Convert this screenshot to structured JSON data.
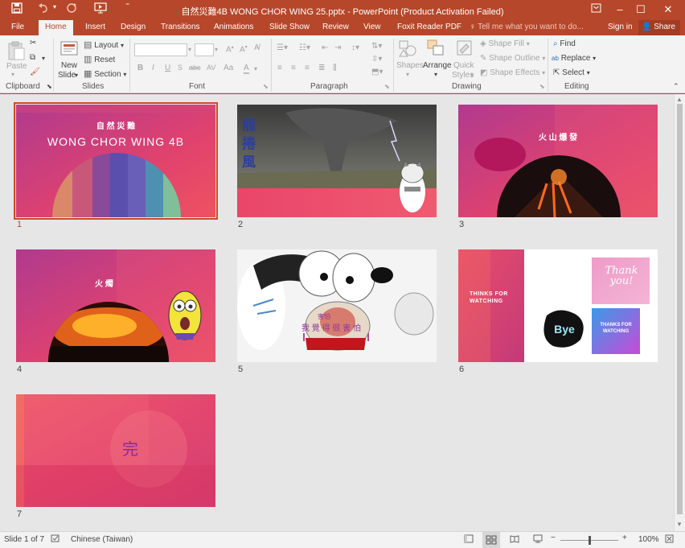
{
  "titlebar": {
    "title": "自然災難4B  WONG CHOR WING  25.pptx - PowerPoint (Product Activation Failed)",
    "save_icon": "save-icon",
    "undo_icon": "undo-icon",
    "redo_icon": "redo-icon",
    "start_icon": "start-from-beginning-icon",
    "customize_icon": "customize-qat-icon"
  },
  "tabs": {
    "file": "File",
    "home": "Home",
    "insert": "Insert",
    "design": "Design",
    "transitions": "Transitions",
    "animations": "Animations",
    "slideshow": "Slide Show",
    "review": "Review",
    "view": "View",
    "foxit": "Foxit Reader PDF",
    "tell": "Tell me what you want to do...",
    "signin": "Sign in",
    "share": "Share"
  },
  "ribbon": {
    "clipboard": {
      "label": "Clipboard",
      "paste": "Paste"
    },
    "slides": {
      "label": "Slides",
      "new_slide": "New",
      "new_slide2": "Slide",
      "layout": "Layout",
      "reset": "Reset",
      "section": "Section"
    },
    "font": {
      "label": "Font",
      "bold": "B",
      "italic": "I",
      "underline": "U",
      "strike": "S",
      "shadow": "abc",
      "spacing": "AV",
      "case": "Aa"
    },
    "paragraph": {
      "label": "Paragraph"
    },
    "drawing": {
      "label": "Drawing",
      "shapes": "Shapes",
      "arrange": "Arrange",
      "quick": "Quick",
      "styles": "Styles",
      "fill": "Shape Fill",
      "outline": "Shape Outline",
      "effects": "Shape Effects"
    },
    "editing": {
      "label": "Editing",
      "find": "Find",
      "replace": "Replace",
      "select": "Select"
    }
  },
  "slides": [
    {
      "num": "1",
      "line1": "自 然 災 難",
      "line2": "WONG CHOR WING 4B"
    },
    {
      "num": "2",
      "text": "龍\n捲\n風"
    },
    {
      "num": "3",
      "text": "火 山 爆 發"
    },
    {
      "num": "4",
      "text": "火 燭"
    },
    {
      "num": "5",
      "text": "我 覺 得 很 害 怕",
      "text_top": "害怕"
    },
    {
      "num": "6",
      "text": "THINKS FOR WATCHING",
      "thank": "Thank you!",
      "bye": "Bye",
      "thanks2": "THANKS FOR WATCHING"
    },
    {
      "num": "7",
      "text": "完"
    }
  ],
  "status": {
    "slide": "Slide 1 of 7",
    "language": "Chinese (Taiwan)",
    "zoom": "100%"
  },
  "colors": {
    "accent": "#b7472a",
    "selection": "#d24726"
  }
}
